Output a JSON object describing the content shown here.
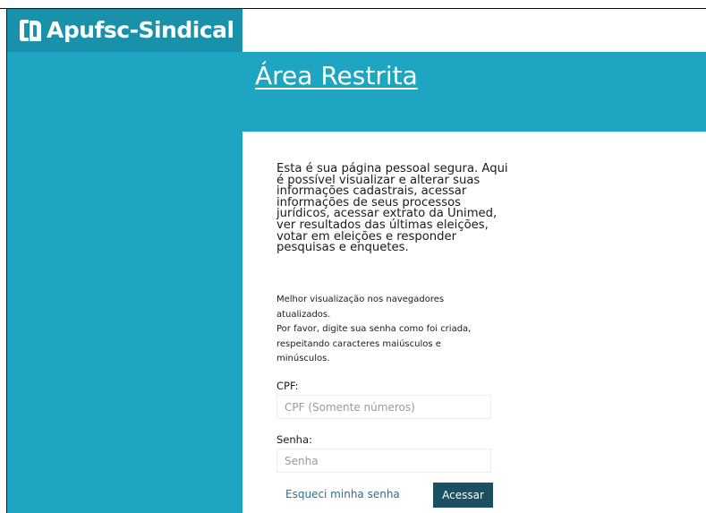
{
  "brand": {
    "logo_text": "Apufsc-Sindical",
    "accent_color": "#1ea5c2",
    "button_color": "#1b4f62",
    "link_color": "#2f6f8f"
  },
  "header": {
    "title": "Área Restrita"
  },
  "main": {
    "intro": "Esta é sua página pessoal segura. Aqui é possível visualizar e alterar suas informações cadastrais, acessar informações de seus processos jurídicos, acessar extrato da Unimed, ver resultados das últimas eleições, votar em eleições e responder pesquisas e enquetes.",
    "note_browsers": "Melhor visualização nos navegadores atualizados.",
    "note_password": "Por favor, digite sua senha como foi criada, respeitando caracteres maiúsculos e minúsculos."
  },
  "form": {
    "cpf_label": "CPF:",
    "cpf_placeholder": "CPF (Somente números)",
    "cpf_value": "",
    "senha_label": "Senha:",
    "senha_placeholder": "Senha",
    "senha_value": "",
    "forgot_label": "Esqueci minha senha",
    "submit_label": "Acessar"
  }
}
